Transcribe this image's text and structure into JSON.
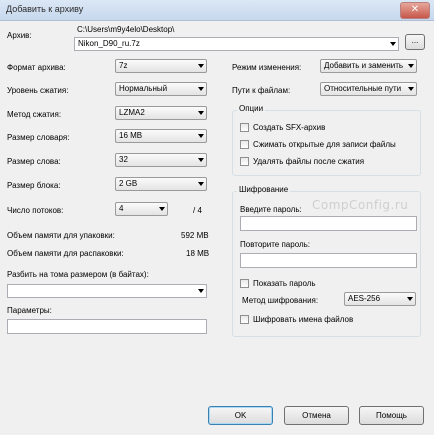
{
  "window": {
    "title": "Добавить к архиву",
    "close_glyph": "✕"
  },
  "archive": {
    "label": "Архив:",
    "path": "C:\\Users\\m9y4elo\\Desktop\\",
    "filename": "Nikon_D90_ru.7z",
    "browse_label": "..."
  },
  "left": {
    "format": {
      "label": "Формат архива:",
      "value": "7z"
    },
    "level": {
      "label": "Уровень сжатия:",
      "value": "Нормальный"
    },
    "method": {
      "label": "Метод сжатия:",
      "value": "LZMA2"
    },
    "dict": {
      "label": "Размер словаря:",
      "value": "16 MB"
    },
    "word": {
      "label": "Размер слова:",
      "value": "32"
    },
    "block": {
      "label": "Размер блока:",
      "value": "2 GB"
    },
    "threads": {
      "label": "Число потоков:",
      "value": "4",
      "max": "/ 4"
    },
    "mem_pack": {
      "label": "Объем памяти для упаковки:",
      "value": "592 MB"
    },
    "mem_unpack": {
      "label": "Объем памяти для распаковки:",
      "value": "18 MB"
    },
    "split": {
      "label": "Разбить на тома размером (в байтах):",
      "value": ""
    },
    "params": {
      "label": "Параметры:",
      "value": ""
    }
  },
  "right": {
    "update_mode": {
      "label": "Режим изменения:",
      "value": "Добавить и заменить"
    },
    "path_mode": {
      "label": "Пути к файлам:",
      "value": "Относительные пути"
    },
    "options": {
      "title": "Опции",
      "sfx": "Создать SFX-архив",
      "shared": "Сжимать открытые для записи файлы",
      "delete_after": "Удалять файлы после сжатия"
    },
    "encryption": {
      "title": "Шифрование",
      "password_label": "Введите пароль:",
      "repeat_label": "Повторите пароль:",
      "show_password": "Показать пароль",
      "method_label": "Метод шифрования:",
      "method_value": "AES-256",
      "encrypt_names": "Шифровать имена файлов"
    }
  },
  "watermark": "CompConfig.ru",
  "buttons": {
    "ok": "OK",
    "cancel": "Отмена",
    "help": "Помощь"
  }
}
